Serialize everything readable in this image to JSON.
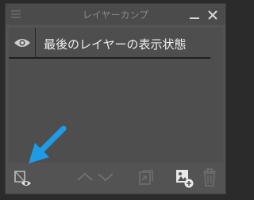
{
  "panel": {
    "title": "レイヤーカンプ"
  },
  "layer_comps": [
    {
      "name": "最後のレイヤーの表示状態",
      "visible": true
    }
  ],
  "toolbar": {
    "icons": [
      "layer-comp-visibility-icon",
      "move-up-icon",
      "move-down-icon",
      "update-comp-icon",
      "new-comp-icon",
      "delete-icon"
    ]
  },
  "colors": {
    "accent_arrow": "#1e9be6",
    "panel_bg": "#535353"
  }
}
